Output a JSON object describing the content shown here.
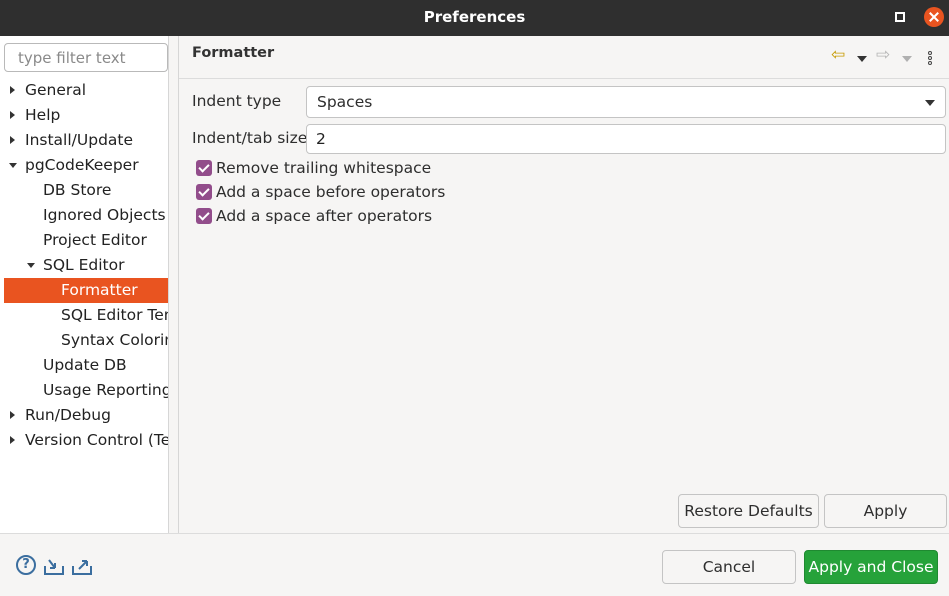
{
  "window": {
    "title": "Preferences"
  },
  "sidebar": {
    "filter_placeholder": "type filter text",
    "items": [
      {
        "label": "General",
        "level": 0,
        "expander": "collapsed"
      },
      {
        "label": "Help",
        "level": 0,
        "expander": "collapsed"
      },
      {
        "label": "Install/Update",
        "level": 0,
        "expander": "collapsed"
      },
      {
        "label": "pgCodeKeeper",
        "level": 0,
        "expander": "expanded"
      },
      {
        "label": "DB Store",
        "level": 1,
        "expander": "none"
      },
      {
        "label": "Ignored Objects",
        "level": 1,
        "expander": "none"
      },
      {
        "label": "Project Editor",
        "level": 1,
        "expander": "none"
      },
      {
        "label": "SQL Editor",
        "level": 1,
        "expander": "expanded"
      },
      {
        "label": "Formatter",
        "level": 2,
        "expander": "none",
        "selected": true
      },
      {
        "label": "SQL Editor Tem",
        "level": 2,
        "expander": "none"
      },
      {
        "label": "Syntax Coloring",
        "level": 2,
        "expander": "none"
      },
      {
        "label": "Update DB",
        "level": 1,
        "expander": "none"
      },
      {
        "label": "Usage Reporting",
        "level": 1,
        "expander": "none"
      },
      {
        "label": "Run/Debug",
        "level": 0,
        "expander": "collapsed"
      },
      {
        "label": "Version Control (Tea",
        "level": 0,
        "expander": "collapsed"
      }
    ]
  },
  "page": {
    "title": "Formatter",
    "nav": {
      "back_icon": "back-arrow-icon",
      "forward_icon": "forward-arrow-icon",
      "menu_icon": "view-menu-icon"
    },
    "indent_type": {
      "label": "Indent type",
      "value": "Spaces"
    },
    "indent_size": {
      "label": "Indent/tab size",
      "value": "2"
    },
    "checks": [
      {
        "label": "Remove trailing whitespace",
        "checked": true
      },
      {
        "label": "Add a space before operators",
        "checked": true
      },
      {
        "label": "Add a space after operators",
        "checked": true
      }
    ],
    "restore_defaults_label": "Restore Defaults",
    "apply_label": "Apply"
  },
  "footer": {
    "cancel_label": "Cancel",
    "apply_close_label": "Apply and Close",
    "icons": [
      "help-icon",
      "import-icon",
      "export-icon"
    ]
  },
  "colors": {
    "selection": "#e95420",
    "checkbox": "#924d8b",
    "primary_button": "#26a23a",
    "titlebar": "#2f2f2f"
  }
}
